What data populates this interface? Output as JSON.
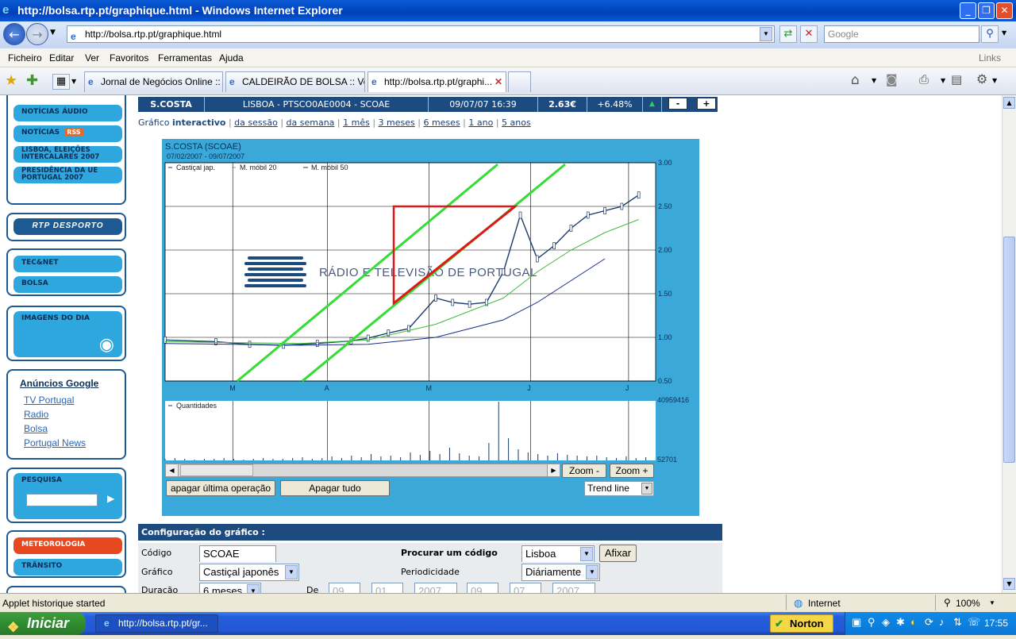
{
  "window": {
    "title": "http://bolsa.rtp.pt/graphique.html - Windows Internet Explorer"
  },
  "toolbar": {
    "address": "http://bolsa.rtp.pt/graphique.html",
    "search_placeholder": "Google"
  },
  "menu": [
    "Ficheiro",
    "Editar",
    "Ver",
    "Favoritos",
    "Ferramentas",
    "Ajuda"
  ],
  "menu_right": "Links",
  "tabs": [
    {
      "label": "Jornal de Negócios Online :: ..."
    },
    {
      "label": "CALDEIRÃO DE BOLSA :: Ver..."
    },
    {
      "label": "http://bolsa.rtp.pt/graphi..."
    }
  ],
  "sidebar": {
    "box1": [
      "NOTÍCIAS ÁUDIO",
      "NOTÍCIAS",
      "LISBOA, ELEIÇÕES INTERCALARES 2007",
      "PRESIDÊNCIA DA UE PORTUGAL 2007"
    ],
    "rss_badge": "RSS",
    "desporto": "RTP DESPORTO",
    "box2": [
      "TEC&NET",
      "BOLSA"
    ],
    "imagens": "IMAGENS DO DIA",
    "ads_title": "Anúncios Google",
    "ads": [
      "TV Portugal",
      "Radio",
      "Bolsa",
      "Portugal News"
    ],
    "pesquisa": "PESQUISA",
    "box3": [
      "METEOROLOGIA",
      "TRÂNSITO"
    ]
  },
  "info": {
    "name": "S.COSTA",
    "isin": "LISBOA - PTSCO0AE0004 - SCOAE",
    "datetime": "09/07/07 16:39",
    "price": "2.63€",
    "change": "+6.48%",
    "arrow": "▲",
    "minus": "-",
    "plus": "+"
  },
  "period": {
    "prefix": "Gráfico",
    "active": "interactivo",
    "links": [
      "da sessão",
      "da semana",
      "1 mês",
      "3 meses",
      "6 meses",
      "1 ano",
      "5 anos"
    ]
  },
  "chart": {
    "title": "S.COSTA (SCOAE)",
    "daterange": "07/02/2007 - 09/07/2007",
    "legend": [
      "Castiçal jap.",
      "M. móbil 20",
      "M. móbil 50"
    ],
    "volume_legend": "Quantidades",
    "watermark": "RÁDIO E TELEVISÃO DE PORTUGAL",
    "y_labels": [
      "3.00",
      "2.50",
      "2.00",
      "1.50",
      "1.00",
      "0.50"
    ],
    "x_labels": [
      "M",
      "A",
      "M",
      "J",
      "J"
    ],
    "vol_max": "40959416",
    "vol_min": "52701",
    "zoom_minus": "Zoom -",
    "zoom_plus": "Zoom +",
    "undo_btn": "apagar última operação",
    "clear_btn": "Apagar tudo",
    "tool_select": "Trend line"
  },
  "chart_data": {
    "type": "line",
    "title": "S.COSTA (SCOAE)",
    "x_ticks": [
      "M",
      "A",
      "M",
      "J",
      "J"
    ],
    "ylim": [
      0.5,
      3.0
    ],
    "series": [
      {
        "name": "Castiçal jap.",
        "x": [
          0,
          15,
          25,
          35,
          45,
          55,
          60,
          66,
          72,
          80,
          85,
          90,
          95,
          100,
          105,
          110,
          115,
          120,
          125,
          130,
          135,
          140
        ],
        "values": [
          0.97,
          0.95,
          0.92,
          0.91,
          0.93,
          0.96,
          0.99,
          1.05,
          1.1,
          1.45,
          1.4,
          1.38,
          1.4,
          1.75,
          2.4,
          1.9,
          2.05,
          2.25,
          2.4,
          2.45,
          2.5,
          2.63
        ]
      },
      {
        "name": "M. móbil 20",
        "x": [
          0,
          20,
          40,
          60,
          80,
          100,
          110,
          120,
          130,
          140
        ],
        "values": [
          0.95,
          0.94,
          0.93,
          0.97,
          1.15,
          1.45,
          1.75,
          2.0,
          2.2,
          2.35
        ]
      },
      {
        "name": "M. móbil 50",
        "x": [
          0,
          20,
          40,
          60,
          80,
          100,
          110,
          120,
          130
        ],
        "values": [
          0.93,
          0.92,
          0.91,
          0.92,
          1.0,
          1.2,
          1.4,
          1.65,
          1.9
        ]
      }
    ]
  },
  "config": {
    "title": "Configuração do gráfico :",
    "codigo_label": "Código",
    "codigo_value": "SCOAE",
    "procurar_label": "Procurar um código",
    "mercado_value": "Lisboa",
    "afixar": "Afixar",
    "grafico_label": "Gráfico",
    "grafico_value": "Castiçal japonês",
    "periodicidade_label": "Periodicidade",
    "periodicidade_value": "Diáriamente",
    "duracao_label": "Duração",
    "duracao_value": "6 meses",
    "de_label": "De",
    "date_parts": [
      "09",
      "01",
      "2007",
      "09",
      "07",
      "2007"
    ]
  },
  "status": {
    "text": "Applet historique started",
    "zone": "Internet",
    "zoom": "100%"
  },
  "taskbar": {
    "start": "Iniciar",
    "window": "http://bolsa.rtp.pt/gr...",
    "norton": "Norton",
    "clock": "17:55"
  }
}
